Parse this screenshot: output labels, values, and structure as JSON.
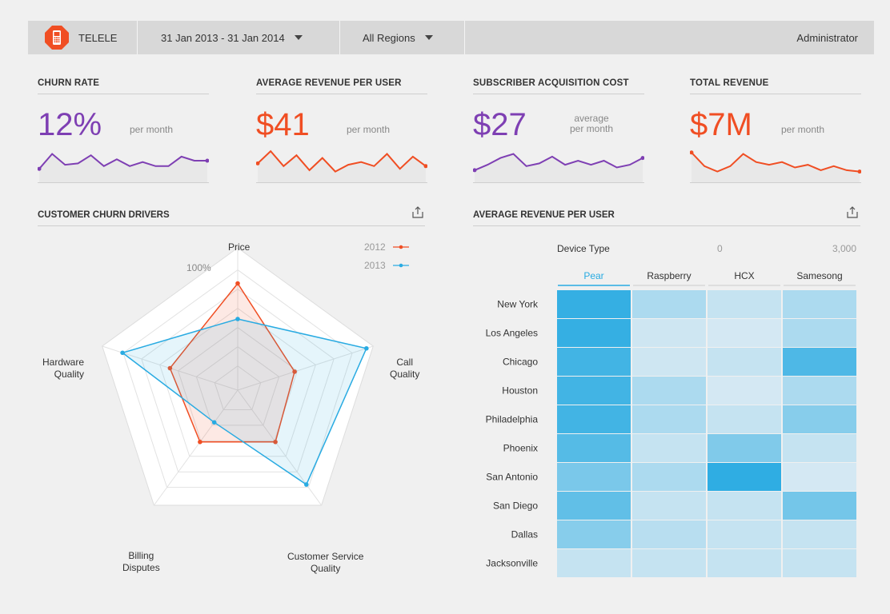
{
  "header": {
    "brand": "TELELE",
    "date_range": "31 Jan 2013 - 31 Jan 2014",
    "region": "All Regions",
    "user": "Administrator",
    "accent": "#f04e23"
  },
  "kpis": [
    {
      "title": "CHURN RATE",
      "value": "12%",
      "sub1": "per month",
      "sub2": "",
      "color": "#7e3fb3",
      "spark": [
        0.2,
        0.75,
        0.35,
        0.4,
        0.7,
        0.3,
        0.55,
        0.3,
        0.45,
        0.3,
        0.3,
        0.65,
        0.5,
        0.5
      ]
    },
    {
      "title": "AVERAGE REVENUE PER USER",
      "value": "$41",
      "sub1": "per month",
      "sub2": "",
      "color": "#f04e23",
      "spark": [
        0.4,
        0.85,
        0.3,
        0.7,
        0.15,
        0.6,
        0.1,
        0.35,
        0.45,
        0.3,
        0.75,
        0.2,
        0.65,
        0.3
      ]
    },
    {
      "title": "SUBSCRIBER ACQUISITION COST",
      "value": "$27",
      "sub1": "average",
      "sub2": "per month",
      "color": "#7e3fb3",
      "spark": [
        0.15,
        0.35,
        0.6,
        0.75,
        0.3,
        0.4,
        0.65,
        0.35,
        0.5,
        0.35,
        0.5,
        0.25,
        0.35,
        0.6
      ]
    },
    {
      "title": "TOTAL REVENUE",
      "value": "$7M",
      "sub1": "per month",
      "sub2": "",
      "color": "#f04e23",
      "spark": [
        0.8,
        0.3,
        0.1,
        0.3,
        0.75,
        0.45,
        0.35,
        0.45,
        0.25,
        0.35,
        0.15,
        0.3,
        0.15,
        0.1
      ]
    }
  ],
  "radar": {
    "title": "CUSTOMER CHURN DRIVERS",
    "max_label": "100%",
    "axes": [
      "Price",
      "Call Quality",
      "Customer Service Quality",
      "Billing Disputes",
      "Hardware Quality"
    ],
    "axis_label_lines": [
      [
        "Price"
      ],
      [
        "Call",
        "Quality"
      ],
      [
        "Customer Service",
        "Quality"
      ],
      [
        "Billing",
        "Disputes"
      ],
      [
        "Hardware",
        "Quality"
      ]
    ],
    "series": [
      {
        "name": "2012",
        "color": "#f04e23",
        "values": [
          0.75,
          0.42,
          0.45,
          0.45,
          0.5
        ]
      },
      {
        "name": "2013",
        "color": "#29abe2",
        "values": [
          0.5,
          0.95,
          0.82,
          0.28,
          0.85
        ]
      }
    ]
  },
  "heatmap": {
    "title": "AVERAGE REVENUE PER USER",
    "device_label": "Device Type",
    "scale_min": "0",
    "scale_max": "3,000",
    "columns": [
      "Pear",
      "Raspberry",
      "HCX",
      "Samesong"
    ],
    "selected_column": "Pear",
    "rows": [
      "New York",
      "Los Angeles",
      "Chicago",
      "Houston",
      "Philadelphia",
      "Phoenix",
      "San Antonio",
      "San Diego",
      "Dallas",
      "Jacksonville"
    ],
    "values": [
      [
        2800,
        900,
        500,
        900
      ],
      [
        2800,
        350,
        250,
        900
      ],
      [
        2600,
        350,
        500,
        2400
      ],
      [
        2600,
        900,
        250,
        900
      ],
      [
        2600,
        900,
        500,
        1500
      ],
      [
        2300,
        500,
        1600,
        500
      ],
      [
        1700,
        900,
        2900,
        250
      ],
      [
        2100,
        500,
        500,
        1800
      ],
      [
        1500,
        700,
        500,
        500
      ],
      [
        500,
        500,
        500,
        500
      ]
    ]
  }
}
